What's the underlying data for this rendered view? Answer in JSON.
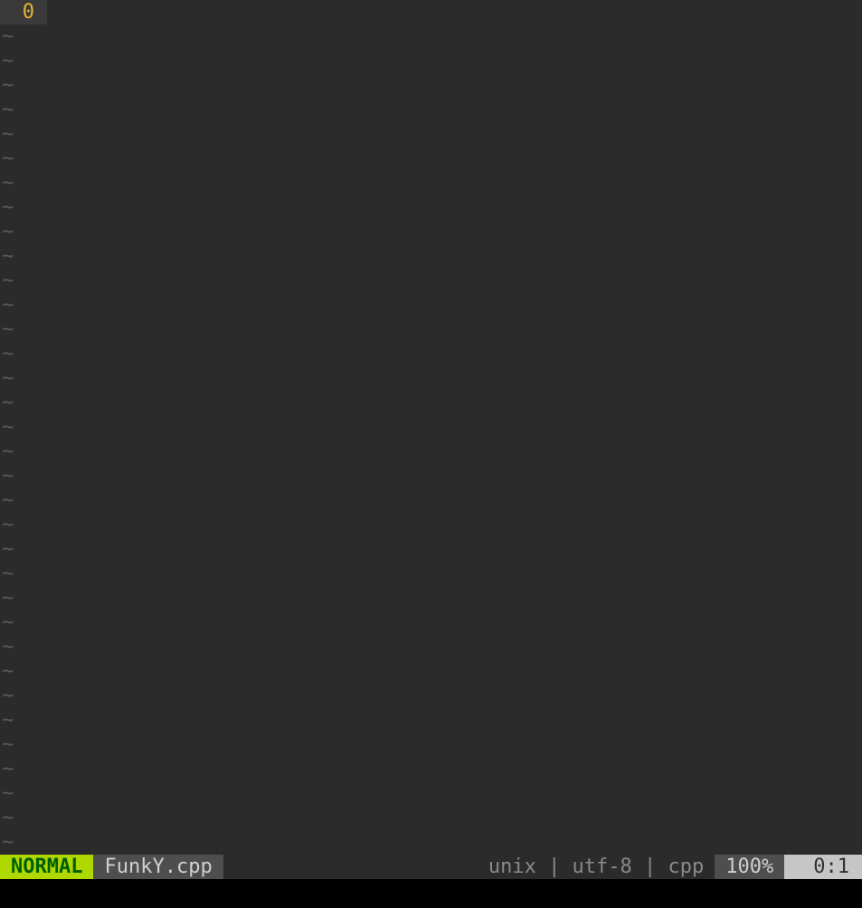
{
  "gutter": {
    "line0": "0"
  },
  "tilde": "~",
  "tilde_count": 34,
  "status": {
    "mode": "NORMAL",
    "filename": "FunkY.cpp",
    "fileinfo": "unix | utf-8 | cpp",
    "percent": "100%",
    "position": "0:1"
  }
}
